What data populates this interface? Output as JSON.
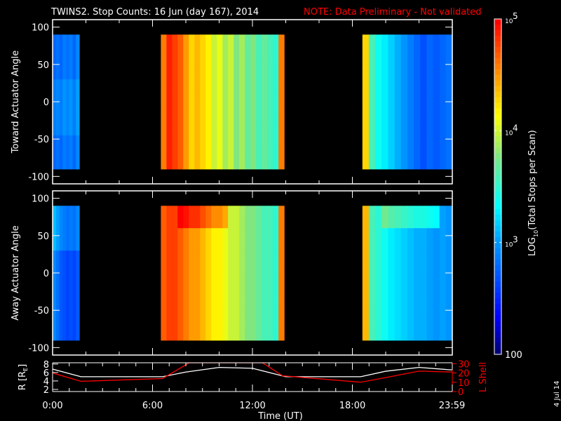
{
  "chart_data": {
    "type": "heatmap",
    "title": "TWINS2. Stop Counts: 16 Jun (day 167), 2014",
    "note": "NOTE: Data Preliminary - Not validated",
    "date_stamp": "4 Jul 14",
    "xlabel": "Time (UT)",
    "xlim": [
      0,
      24
    ],
    "x_ticks": [
      {
        "v": 0,
        "label": "0:00"
      },
      {
        "v": 6,
        "label": "6:00"
      },
      {
        "v": 12,
        "label": "12:00"
      },
      {
        "v": 18,
        "label": "18:00"
      },
      {
        "v": 23.98,
        "label": "23:59"
      }
    ],
    "panels": [
      {
        "ylabel": "Toward Actuator Angle",
        "ylim": [
          -110,
          110
        ],
        "y_ticks": [
          "100",
          "50",
          "0",
          "-50",
          "-100"
        ],
        "y_values": [
          100,
          50,
          0,
          -50,
          -100
        ],
        "segments": [
          {
            "start": 0.0,
            "end": 1.6,
            "log_counts": [
              2.8,
              2.85,
              2.8,
              2.9,
              2.85,
              2.9,
              2.8,
              2.95
            ]
          },
          {
            "start": 6.5,
            "end": 13.9,
            "log_counts": [
              4.6,
              4.9,
              4.8,
              4.7,
              4.5,
              4.3,
              4.4,
              4.3,
              4.2,
              4.0,
              4.1,
              3.9,
              4.0,
              3.8,
              3.9,
              3.7,
              3.8,
              3.6,
              3.7,
              3.6,
              3.5,
              4.6
            ]
          },
          {
            "start": 18.6,
            "end": 24.0,
            "log_counts": [
              4.3,
              3.6,
              3.4,
              3.3,
              3.2,
              3.1,
              3.0,
              2.9,
              2.8,
              2.7,
              2.8,
              2.75,
              2.8,
              2.85
            ]
          }
        ]
      },
      {
        "ylabel": "Away Actuator Angle",
        "ylim": [
          -110,
          110
        ],
        "y_ticks": [
          "100",
          "50",
          "0",
          "-50",
          "-100"
        ],
        "y_values": [
          100,
          50,
          0,
          -50,
          -100
        ],
        "segments": [
          {
            "start": 0.0,
            "end": 1.6,
            "log_counts": [
              3.0,
              2.9,
              2.8,
              2.75,
              2.7,
              2.75,
              2.7,
              2.8
            ]
          },
          {
            "start": 6.5,
            "end": 13.9,
            "log_counts": [
              4.7,
              4.8,
              4.8,
              4.7,
              4.6,
              4.5,
              4.5,
              4.4,
              4.3,
              4.2,
              4.2,
              4.1,
              4.0,
              4.0,
              3.9,
              3.8,
              3.8,
              3.7,
              3.6,
              3.6,
              3.5,
              4.6
            ]
          },
          {
            "start": 18.6,
            "end": 24.0,
            "log_counts": [
              4.4,
              3.6,
              3.5,
              3.4,
              3.3,
              3.25,
              3.2,
              3.15,
              3.1,
              3.1,
              3.05,
              3.0,
              3.05,
              3.0
            ]
          }
        ]
      }
    ],
    "colorbar": {
      "label": "LOG10(Total Stops per Scan)",
      "label_main": "LOG",
      "label_sub": "10",
      "label_rest": "(Total Stops per Scan)",
      "range": [
        2,
        5
      ],
      "ticks": [
        {
          "v": 5,
          "base": "10",
          "exp": "5"
        },
        {
          "v": 4,
          "base": "10",
          "exp": "4"
        },
        {
          "v": 3,
          "base": "10",
          "exp": "3"
        },
        {
          "v": 2,
          "base": "100",
          "exp": ""
        }
      ]
    },
    "orbit": {
      "ylabel_left": "R [RE]",
      "ylabel_left_main": "R [R",
      "ylabel_left_sub": "E",
      "ylabel_left_end": "]",
      "ylim_left": [
        1.5,
        8.3
      ],
      "left_ticks": [
        "8",
        "6",
        "4",
        "2"
      ],
      "left_values": [
        8,
        6,
        4,
        2
      ],
      "ylabel_right": "L Shell",
      "ylim_right": [
        0,
        31
      ],
      "right_ticks": [
        "30",
        "20",
        "10",
        "0"
      ],
      "right_values": [
        30,
        20,
        10,
        0
      ],
      "R": {
        "t": [
          0,
          1.7,
          6.6,
          8,
          10,
          12,
          14,
          18.5,
          20,
          22,
          24
        ],
        "v": [
          6.8,
          5.0,
          5.0,
          6.1,
          7.2,
          7.0,
          5.0,
          5.0,
          6.3,
          7.2,
          6.6
        ]
      },
      "L": {
        "t": [
          0,
          1.7,
          6.6,
          8.2,
          12.6,
          13.8,
          18.5,
          20,
          22,
          24
        ],
        "v": [
          20,
          11,
          14,
          31,
          31,
          17,
          10,
          15,
          22,
          21
        ]
      },
      "R_color": "#ffffff",
      "L_color": "#ff0000"
    }
  }
}
